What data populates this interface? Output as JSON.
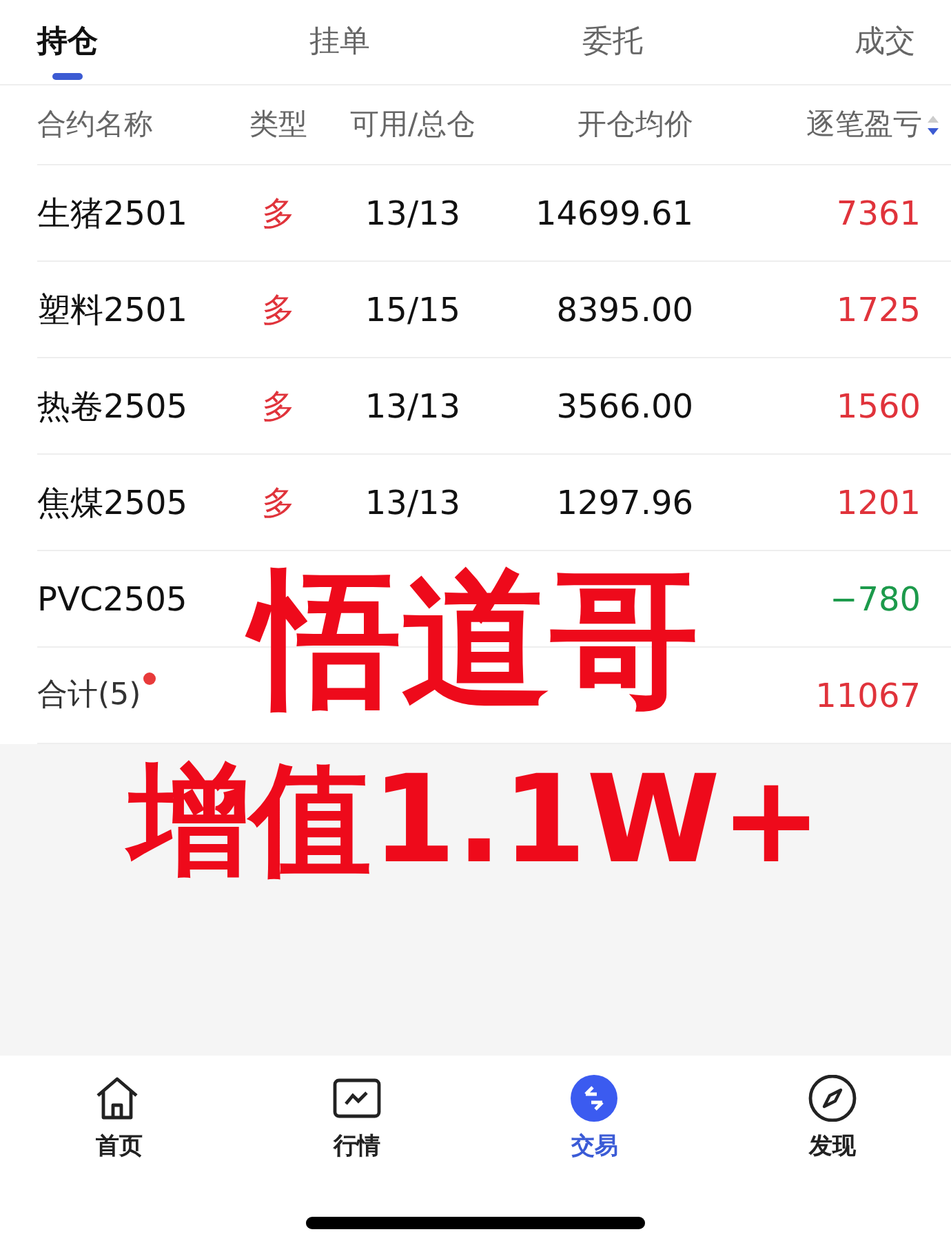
{
  "tabs": [
    {
      "label": "持仓",
      "selected": true
    },
    {
      "label": "挂单",
      "selected": false
    },
    {
      "label": "委托",
      "selected": false
    },
    {
      "label": "成交",
      "selected": false
    }
  ],
  "table": {
    "columns": [
      "合约名称",
      "类型",
      "可用/总仓",
      "开仓均价",
      "逐笔盈亏"
    ],
    "rows": [
      {
        "name": "生猪2501",
        "type": "多",
        "available": "13/13",
        "avg_price": "14699.61",
        "pnl": "7361",
        "color": "#e0333b"
      },
      {
        "name": "塑料2501",
        "type": "多",
        "available": "15/15",
        "avg_price": "8395.00",
        "pnl": "1725",
        "color": "#e0333b"
      },
      {
        "name": "热卷2505",
        "type": "多",
        "available": "13/13",
        "avg_price": "3566.00",
        "pnl": "1560",
        "color": "#e0333b"
      },
      {
        "name": "焦煤2505",
        "type": "多",
        "available": "13/13",
        "avg_price": "1297.96",
        "pnl": "1201",
        "color": "#e0333b"
      },
      {
        "name": "PVC2505",
        "pnl": "−780",
        "color": "#1c9a4b"
      }
    ],
    "total": {
      "label": "合计(5)",
      "unread": true,
      "pnl": "11067",
      "color": "#e0333b"
    }
  },
  "overlay_text": [
    "悟道哥",
    "增值1.1W+"
  ],
  "bottom_nav": [
    {
      "label": "首页",
      "selected": false
    },
    {
      "label": "行情",
      "selected": false
    },
    {
      "label": "交易",
      "selected": true
    },
    {
      "label": "发现",
      "selected": false
    }
  ]
}
